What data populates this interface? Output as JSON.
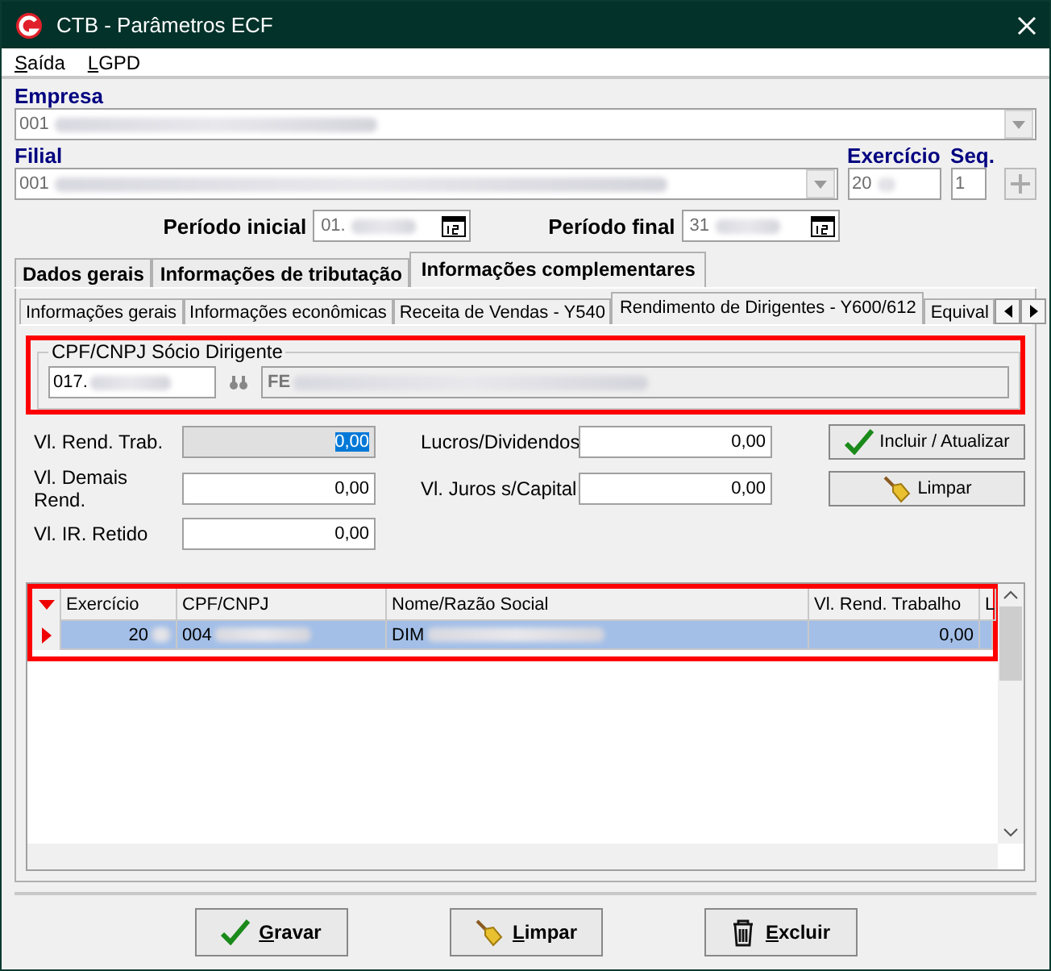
{
  "window": {
    "title": "CTB - Parâmetros ECF"
  },
  "menu": [
    {
      "label": "Saída"
    },
    {
      "label": "LGPD"
    }
  ],
  "empresa": {
    "label": "Empresa",
    "value": "001"
  },
  "filial": {
    "label": "Filial",
    "value": "001"
  },
  "exercicio": {
    "label": "Exercício",
    "value": "20"
  },
  "seq": {
    "label": "Seq.",
    "value": "1"
  },
  "periodo_inicial": {
    "label": "Período inicial",
    "value": "01."
  },
  "periodo_final": {
    "label": "Período final",
    "value": "31"
  },
  "tabs": [
    {
      "label": "Dados gerais",
      "selected": false
    },
    {
      "label": "Informações de tributação",
      "selected": false
    },
    {
      "label": "Informações complementares",
      "selected": true
    }
  ],
  "subtabs": [
    {
      "label": "Informações gerais",
      "selected": false
    },
    {
      "label": "Informações econômicas",
      "selected": false
    },
    {
      "label": "Receita de Vendas - Y540",
      "selected": false
    },
    {
      "label": "Rendimento de Dirigentes - Y600/612",
      "selected": true
    },
    {
      "label": "Equival",
      "selected": false
    }
  ],
  "socio": {
    "legend": "CPF/CNPJ Sócio Dirigente",
    "cpf": "017.",
    "name": "FE",
    "highlighted": true
  },
  "fields_left": [
    {
      "label": "Vl. Rend. Trab.",
      "value": "0,00",
      "disabled": true,
      "text_selected": true
    },
    {
      "label": "Vl. Demais Rend.",
      "value": "0,00",
      "disabled": false,
      "text_selected": false
    },
    {
      "label": "Vl. IR. Retido",
      "value": "0,00",
      "disabled": false,
      "text_selected": false
    }
  ],
  "fields_right": [
    {
      "label": "Lucros/Dividendos",
      "value": "0,00",
      "disabled": false,
      "text_selected": false
    },
    {
      "label": "Vl. Juros s/Capital",
      "value": "0,00",
      "disabled": false,
      "text_selected": false
    }
  ],
  "actions": [
    {
      "label": "Incluir / Atualizar",
      "kind": "check"
    },
    {
      "label": "Limpar",
      "kind": "broom"
    }
  ],
  "grid": {
    "highlighted": true,
    "columns": [
      "Exercício",
      "CPF/CNPJ",
      "Nome/Razão Social",
      "Vl. Rend. Trabalho",
      "L"
    ],
    "rows": [
      {
        "selected": true,
        "cells": [
          "20",
          "004",
          "DIM",
          "0,00"
        ]
      }
    ]
  },
  "buttons": [
    {
      "label": "Gravar",
      "kind": "check"
    },
    {
      "label": "Limpar",
      "kind": "broom"
    },
    {
      "label": "Excluir",
      "kind": "trash"
    }
  ]
}
